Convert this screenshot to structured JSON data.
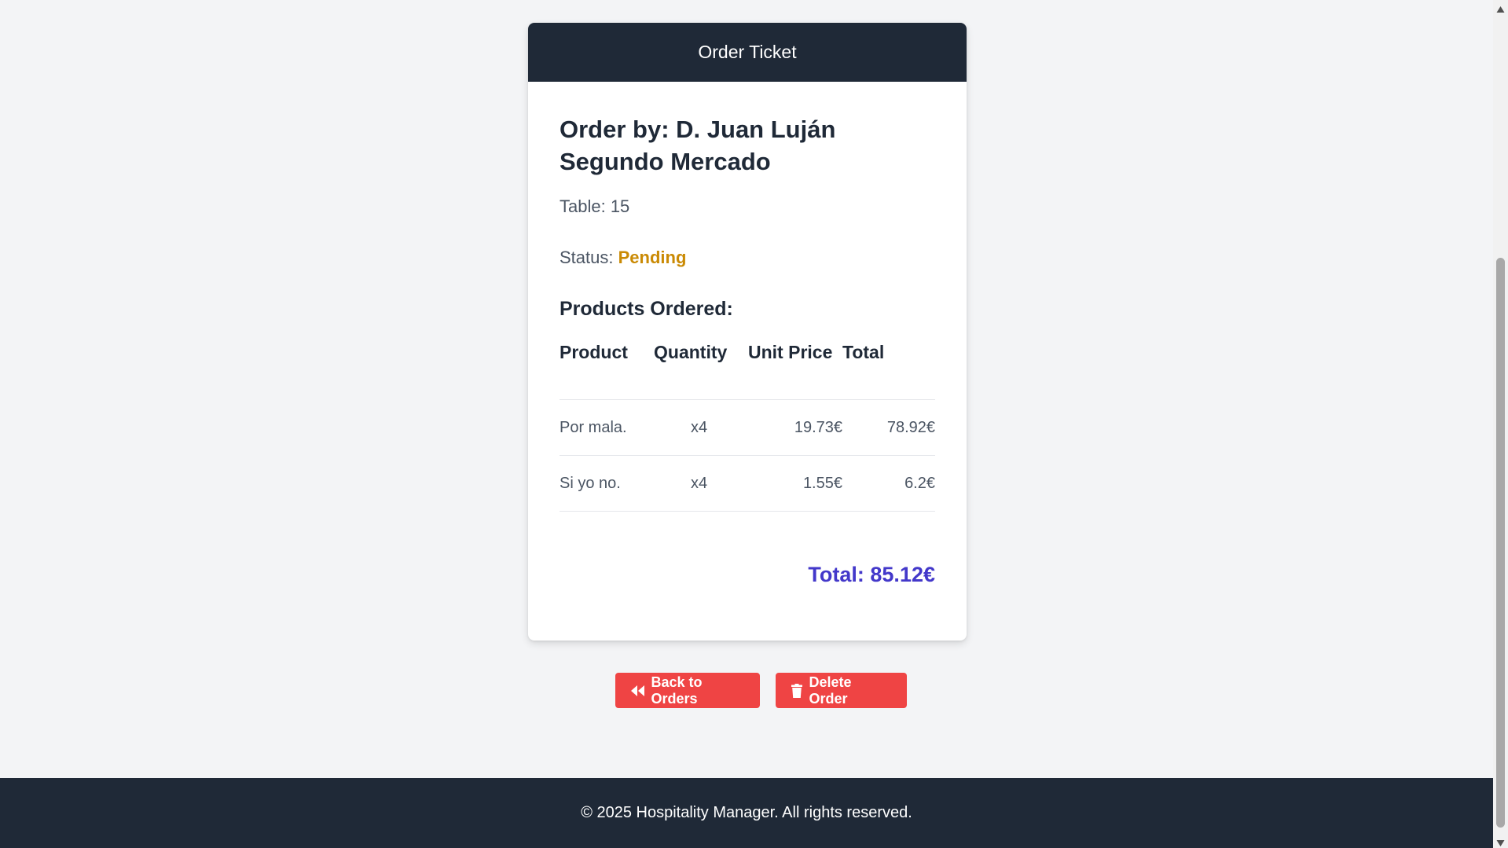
{
  "header": {
    "title": "Order Ticket"
  },
  "order": {
    "customer_prefix": "Order by:",
    "customer_name": "D. Juan Luján Segundo Mercado",
    "table_label": "Table: 15",
    "status_label": "Status:",
    "status_value": "Pending",
    "status_color": "#ca8a04"
  },
  "products": {
    "heading": "Products Ordered:",
    "columns": [
      "Product",
      "Quantity",
      "Unit Price",
      "Total"
    ],
    "rows": [
      {
        "product": "Por mala.",
        "quantity": "x4",
        "unit_price": "19.73€",
        "total": "78.92€"
      },
      {
        "product": "Si yo no.",
        "quantity": "x4",
        "unit_price": "1.55€",
        "total": "6.2€"
      }
    ]
  },
  "total": {
    "label": "Total: 85.12€",
    "color": "#4338ca"
  },
  "actions": {
    "back_label": "Back to Orders",
    "back_icon": "backward-icon",
    "delete_label": "Delete Order",
    "delete_icon": "trash-icon",
    "button_color": "#ef4444"
  },
  "footer": {
    "text": "© 2025 Hospitality Manager. All rights reserved."
  }
}
